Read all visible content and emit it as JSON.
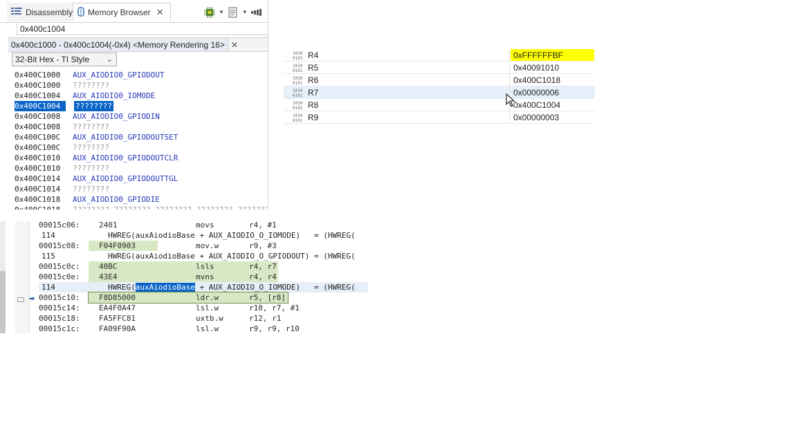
{
  "tabs": [
    {
      "label": "Disassembly",
      "icon": "disassembly-icon",
      "active": false
    },
    {
      "label": "Memory Browser",
      "icon": "memory-browser-icon",
      "active": true
    }
  ],
  "toolbar_icons": [
    "chip-settings-icon",
    "new-rendering-icon",
    "more-icon"
  ],
  "address_input": {
    "value": "0x400c1004"
  },
  "rendering_tab": {
    "label": "0x400c1000 - 0x400c1004(-0x4) <Memory Rendering 16>"
  },
  "format_select": {
    "value": "32-Bit Hex - TI Style"
  },
  "memory_rows": [
    {
      "addr": "0x400C1000",
      "value": "AUX_AIODIO0_GPIODOUT",
      "kind": "name"
    },
    {
      "addr": "0x400C1000",
      "value": "????????",
      "kind": "unknown"
    },
    {
      "addr": "0x400C1004",
      "value": "AUX_AIODIO0_IOMODE",
      "kind": "name"
    },
    {
      "addr": "0x400C1004",
      "value": "????????",
      "kind": "selected"
    },
    {
      "addr": "0x400C1008",
      "value": "AUX_AIODIO0_GPIODIN",
      "kind": "name"
    },
    {
      "addr": "0x400C1008",
      "value": "????????",
      "kind": "unknown"
    },
    {
      "addr": "0x400C100C",
      "value": "AUX_AIODIO0_GPIODOUTSET",
      "kind": "name"
    },
    {
      "addr": "0x400C100C",
      "value": "????????",
      "kind": "unknown"
    },
    {
      "addr": "0x400C1010",
      "value": "AUX_AIODIO0_GPIODOUTCLR",
      "kind": "name"
    },
    {
      "addr": "0x400C1010",
      "value": "????????",
      "kind": "unknown"
    },
    {
      "addr": "0x400C1014",
      "value": "AUX_AIODIO0_GPIODOUTTGL",
      "kind": "name"
    },
    {
      "addr": "0x400C1014",
      "value": "????????",
      "kind": "unknown"
    },
    {
      "addr": "0x400C1018",
      "value": "AUX_AIODIO0_GPIODIE",
      "kind": "name"
    },
    {
      "addr": "0x400C1018",
      "value": "???????? ???????? ???????? ???????? ????????",
      "kind": "cut"
    }
  ],
  "registers": [
    {
      "name": "R4",
      "value": "0xFFFFFFBF",
      "changed": true
    },
    {
      "name": "R5",
      "value": "0x40091010",
      "changed": false
    },
    {
      "name": "R6",
      "value": "0x400C1018",
      "changed": false
    },
    {
      "name": "R7",
      "value": "0x00000006",
      "changed": false
    },
    {
      "name": "R8",
      "value": "0x400C1004",
      "changed": false
    },
    {
      "name": "R9",
      "value": "0x00000003",
      "changed": false
    }
  ],
  "disassembly": [
    {
      "type": "asm",
      "addr": "00015c06:",
      "op": "2401",
      "mn": "movs",
      "args": "r4, #1"
    },
    {
      "type": "src",
      "num": "114",
      "text": "HWREG(auxAiodioBase + AUX_AIODIO_O_IOMODE)   = (HWREG("
    },
    {
      "type": "asm",
      "addr": "00015c08:",
      "op": "F04F0903",
      "mn": "mov.w",
      "args": "r9, #3"
    },
    {
      "type": "src",
      "num": "115",
      "text": "HWREG(auxAiodioBase + AUX_AIODIO_O_GPIODOUT) = (HWREG("
    },
    {
      "type": "asm",
      "addr": "00015c0c:",
      "op": "40BC",
      "mn": "lsls",
      "args": "r4, r7"
    },
    {
      "type": "asm",
      "addr": "00015c0e:",
      "op": "43E4",
      "mn": "mvns",
      "args": "r4, r4"
    },
    {
      "type": "src",
      "num": "114",
      "text_before": "HWREG(",
      "selected_word": "auxAiodioBase",
      "text_after": " + AUX_AIODIO_O_IOMODE)   = (HWREG("
    },
    {
      "type": "asm",
      "addr": "00015c10:",
      "op": "F8D85000",
      "mn": "ldr.w",
      "args": "r5, [r8]"
    },
    {
      "type": "asm",
      "addr": "00015c14:",
      "op": "EA4F0A47",
      "mn": "lsl.w",
      "args": "r10, r7, #1"
    },
    {
      "type": "asm",
      "addr": "00015c18:",
      "op": "FA5FFC81",
      "mn": "uxtb.w",
      "args": "r12, r1"
    },
    {
      "type": "asm",
      "addr": "00015c1c:",
      "op": "FA09F90A",
      "mn": "lsl.w",
      "args": "r9, r9, r10"
    }
  ]
}
